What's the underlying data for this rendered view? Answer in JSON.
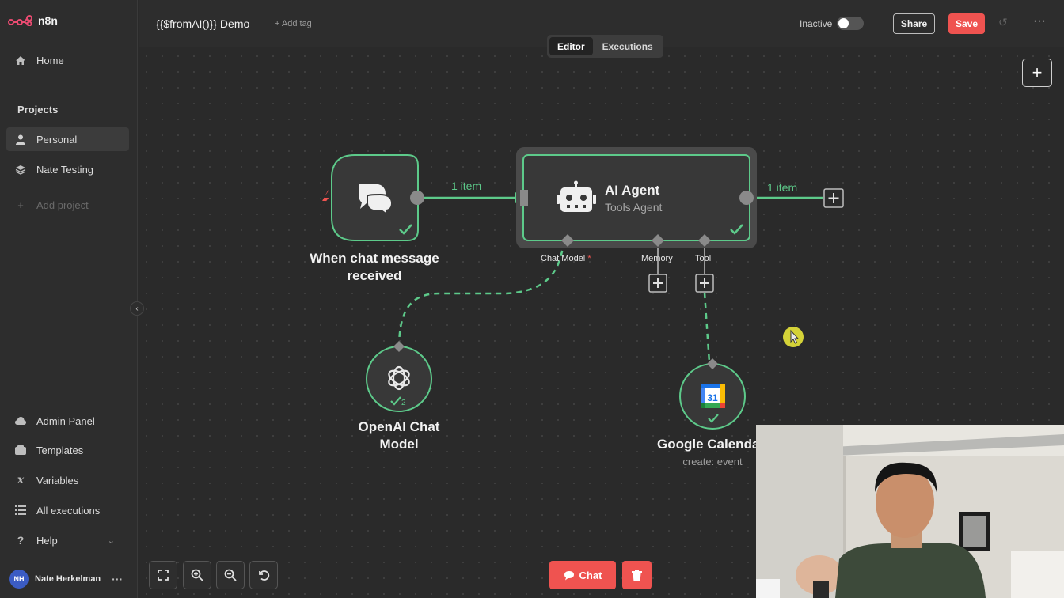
{
  "app": {
    "name": "n8n"
  },
  "sidebar": {
    "home": "Home",
    "projects_title": "Projects",
    "projects": [
      "Personal",
      "Nate Testing"
    ],
    "add_project": "Add project",
    "bottom": [
      "Admin Panel",
      "Templates",
      "Variables",
      "All executions",
      "Help"
    ],
    "user": {
      "initials": "NH",
      "name": "Nate Herkelman"
    }
  },
  "header": {
    "workflow_title": "{{$fromAI()}} Demo",
    "add_tag": "+ Add tag",
    "status": "Inactive",
    "share": "Share",
    "save": "Save",
    "tabs": [
      "Editor",
      "Executions"
    ]
  },
  "canvas": {
    "trigger": {
      "label_line1": "When chat message",
      "label_line2": "received"
    },
    "agent": {
      "title": "AI Agent",
      "subtitle": "Tools Agent"
    },
    "connections": {
      "item_in": "1 item",
      "item_out": "1 item"
    },
    "agent_inputs": {
      "chat_model": "Chat Model",
      "required_mark": "*",
      "memory": "Memory",
      "tool": "Tool"
    },
    "openai": {
      "label_line1": "OpenAI Chat",
      "label_line2": "Model",
      "badge": "2"
    },
    "gcal": {
      "label": "Google Calenda",
      "sub": "create: event",
      "icon_text": "31"
    }
  },
  "toolbar": {
    "chat": "Chat"
  },
  "colors": {
    "accent": "#ef5350",
    "success": "#5dca8a",
    "background": "#2a2a2a"
  }
}
